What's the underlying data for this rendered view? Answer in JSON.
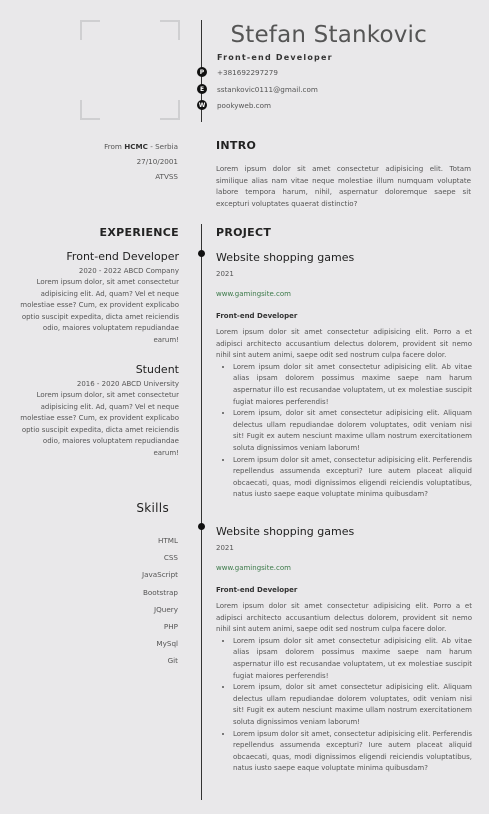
{
  "header": {
    "name": "Stefan Stankovic",
    "role": "Front-end Developer",
    "contacts": [
      {
        "icon": "P",
        "icon_name": "phone-icon",
        "value": "+381692297279"
      },
      {
        "icon": "E",
        "icon_name": "email-icon",
        "value": "sstankovic0111@gmail.com"
      },
      {
        "icon": "W",
        "icon_name": "website-icon",
        "value": "pookyweb.com"
      }
    ]
  },
  "personal": {
    "from_prefix": "From ",
    "from_city": "HCMC",
    "from_country": " - Serbia",
    "dob": "27/10/2001",
    "school": "ATVSS"
  },
  "intro": {
    "heading": "INTRO",
    "text": "Lorem ipsum dolor sit amet consectetur adipisicing elit. Totam similique alias nam vitae neque molestiae illum numquam voluptate labore tempora harum, nihil, aspernatur doloremque saepe sit excepturi voluptates quaerat distinctio?"
  },
  "experience": {
    "heading": "EXPERIENCE",
    "items": [
      {
        "title": "Front-end Developer",
        "dates": "2020 - 2022 ABCD Company",
        "text": "Lorem ipsum dolor, sit amet consectetur adipisicing elit. Ad, quam? Vel et neque molestiae esse? Cum, ex provident explicabo optio suscipit expedita, dicta amet reiciendis odio, maiores voluptatem repudiandae earum!"
      },
      {
        "title": "Student",
        "dates": "2016 - 2020 ABCD University",
        "text": "Lorem ipsum dolor, sit amet consectetur adipisicing elit. Ad, quam? Vel et neque molestiae esse? Cum, ex provident explicabo optio suscipit expedita, dicta amet reiciendis odio, maiores voluptatem repudiandae earum!"
      }
    ]
  },
  "skills": {
    "heading": "Skills",
    "items": [
      "HTML",
      "CSS",
      "JavaScript",
      "Bootstrap",
      "JQuery",
      "PHP",
      "MySql",
      "Git"
    ]
  },
  "project": {
    "heading": "PROJECT",
    "items": [
      {
        "title": "Website shopping games",
        "year": "2021",
        "link": "www.gamingsite.com",
        "role": "Front-end Developer",
        "desc": "Lorem ipsum dolor sit amet consectetur adipisicing elit. Porro a et adipisci architecto accusantium delectus dolorem, provident sit nemo nihil sint autem animi, saepe odit sed nostrum culpa facere dolor.",
        "bullets": [
          "Lorem ipsum dolor sit amet consectetur adipisicing elit. Ab vitae alias ipsam dolorem possimus maxime saepe nam harum aspernatur illo est recusandae voluptatem, ut ex molestiae suscipit fugiat maiores perferendis!",
          "Lorem ipsum, dolor sit amet consectetur adipisicing elit. Aliquam delectus ullam repudiandae dolorem voluptates, odit veniam nisi sit! Fugit ex autem nesciunt maxime ullam nostrum exercitationem soluta dignissimos veniam laborum!",
          "Lorem ipsum dolor sit amet, consectetur adipisicing elit. Perferendis repellendus assumenda excepturi? Iure autem placeat aliquid obcaecati, quas, modi dignissimos eligendi reiciendis voluptatibus, natus iusto saepe eaque voluptate minima quibusdam?"
        ]
      },
      {
        "title": "Website shopping games",
        "year": "2021",
        "link": "www.gamingsite.com",
        "role": "Front-end Developer",
        "desc": "Lorem ipsum dolor sit amet consectetur adipisicing elit. Porro a et adipisci architecto accusantium delectus dolorem, provident sit nemo nihil sint autem animi, saepe odit sed nostrum culpa facere dolor.",
        "bullets": [
          "Lorem ipsum dolor sit amet consectetur adipisicing elit. Ab vitae alias ipsam dolorem possimus maxime saepe nam harum aspernatur illo est recusandae voluptatem, ut ex molestiae suscipit fugiat maiores perferendis!",
          "Lorem ipsum, dolor sit amet consectetur adipisicing elit. Aliquam delectus ullam repudiandae dolorem voluptates, odit veniam nisi sit! Fugit ex autem nesciunt maxime ullam nostrum exercitationem soluta dignissimos veniam laborum!",
          "Lorem ipsum dolor sit amet, consectetur adipisicing elit. Perferendis repellendus assumenda excepturi? Iure autem placeat aliquid obcaecati, quas, modi dignissimos eligendi reiciendis voluptatibus, natus iusto saepe eaque voluptate minima quibusdam?"
        ]
      }
    ]
  }
}
